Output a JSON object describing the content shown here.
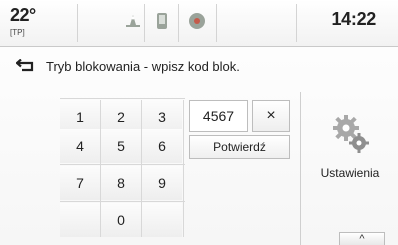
{
  "status": {
    "temperature": "22°",
    "tp": "[TP]",
    "time": "14:22"
  },
  "tabs": [
    {
      "icon": "audio-icon"
    },
    {
      "icon": "phone-icon"
    },
    {
      "icon": "navigation-icon"
    }
  ],
  "lock": {
    "title": "Tryb blokowania - wpisz kod blok.",
    "code_value": "4567",
    "clear_label": "×",
    "confirm_label": "Potwierdź",
    "keys": [
      "1",
      "2",
      "3",
      "4",
      "5",
      "6",
      "7",
      "8",
      "9",
      "",
      "0",
      ""
    ]
  },
  "side": {
    "settings_label": "Ustawienia",
    "collapse_label": "^"
  },
  "colors": {
    "text": "#222222",
    "border": "#bdbdbd",
    "background": "#ffffff"
  }
}
